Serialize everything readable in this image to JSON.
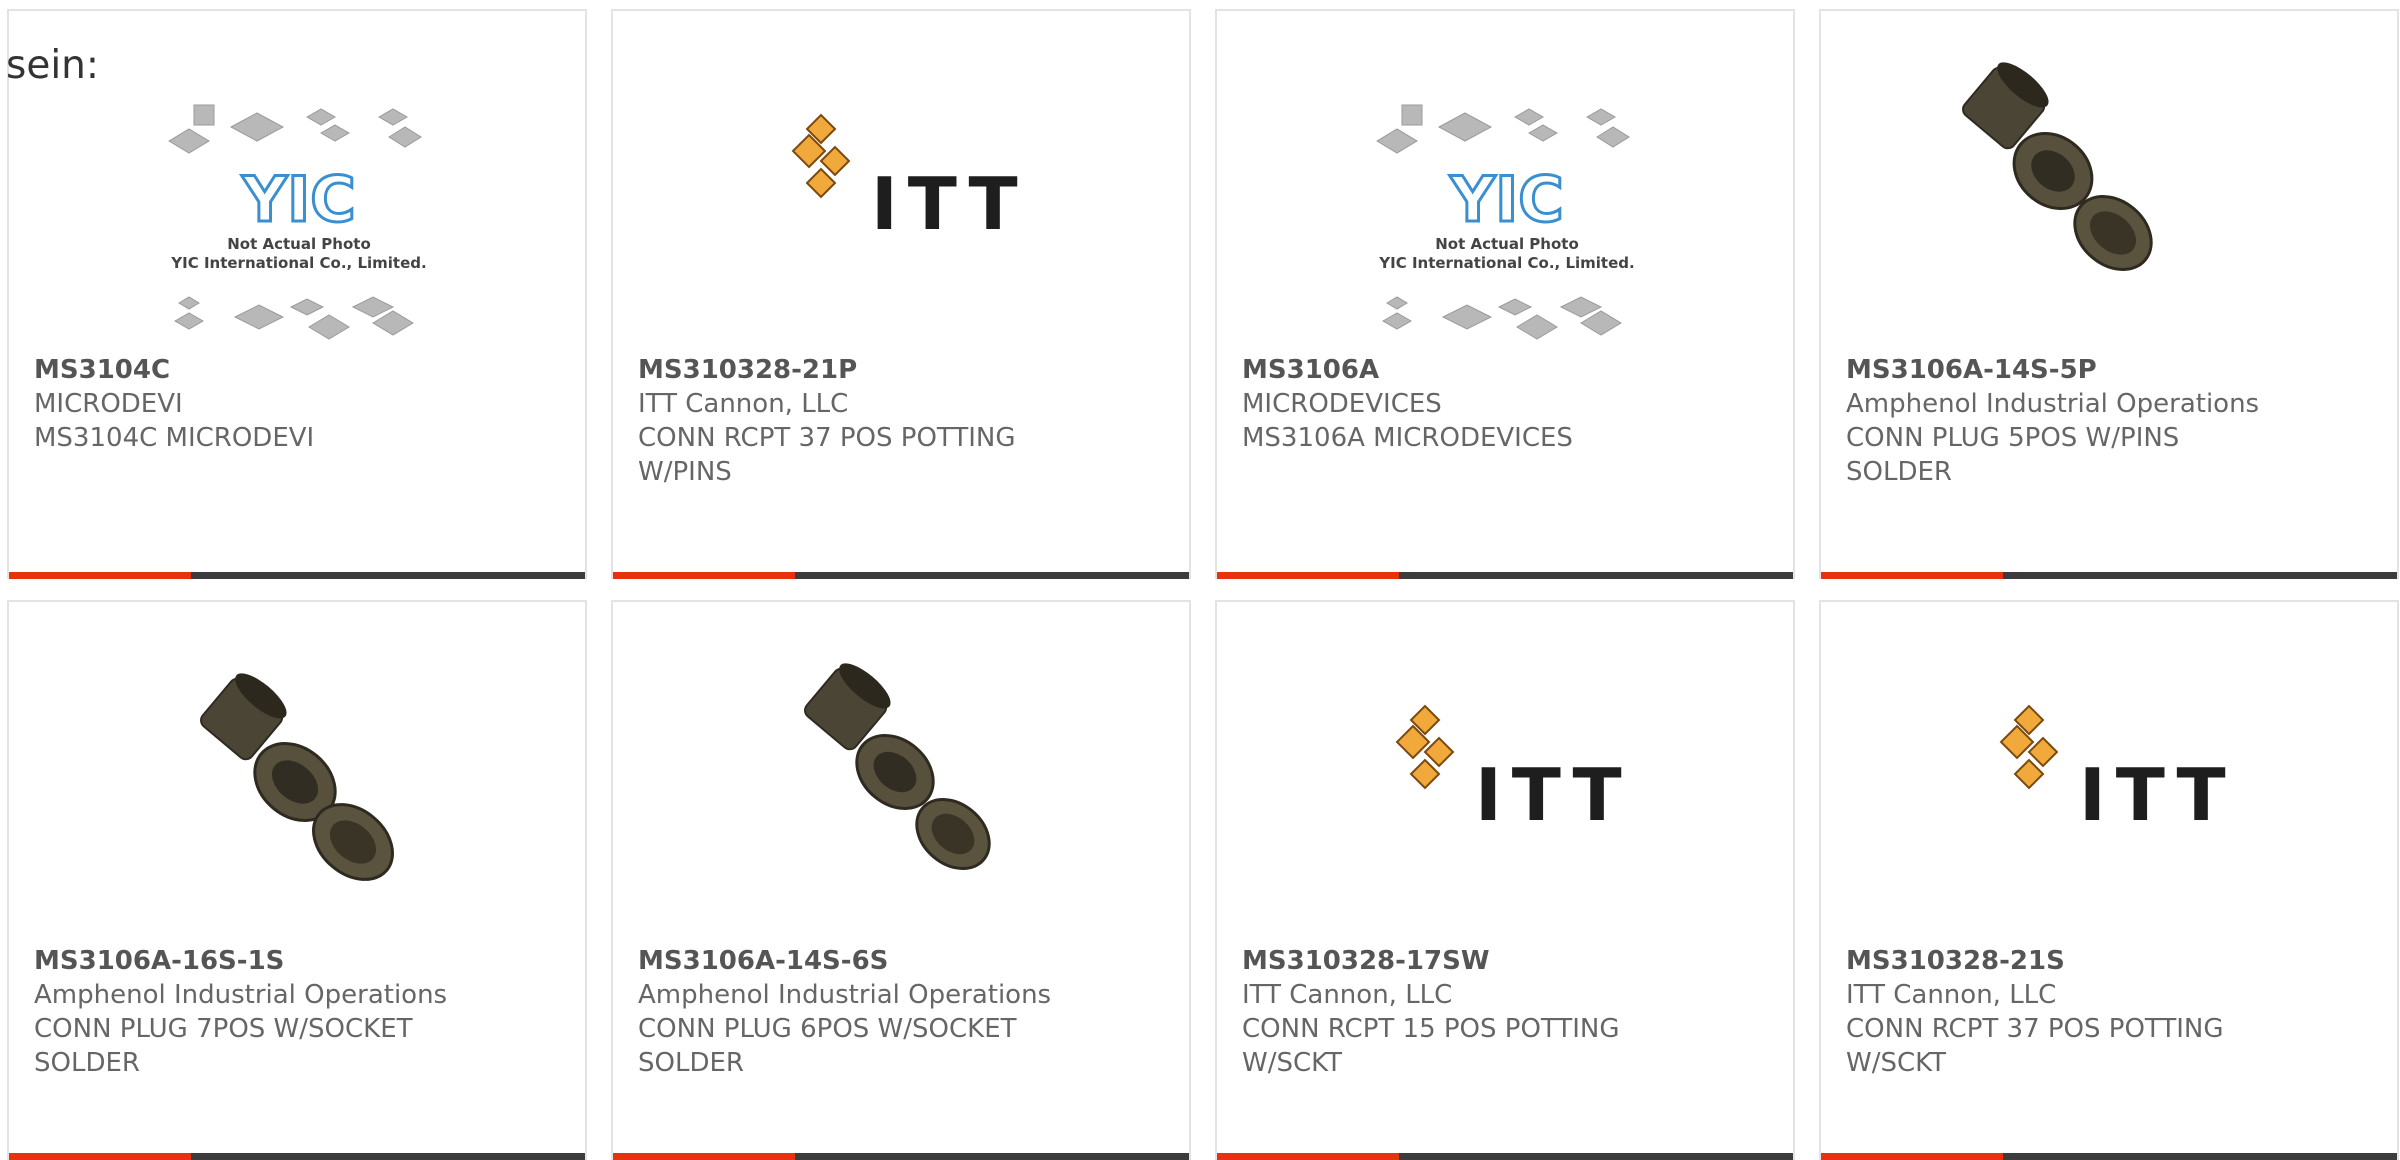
{
  "intro_text": "sein:",
  "colors": {
    "accent": "#e8320e",
    "bar": "#3c3c3c",
    "border": "#e3e3e3",
    "itt_gold": "#f2a93b",
    "yic_blue": "#3a8fd1"
  },
  "products": [
    {
      "part_number": "MS3104C",
      "manufacturer": "MICRODEVI",
      "description": "MS3104C MICRODEVI",
      "image": "yic-placeholder-image",
      "image_text": [
        "YIC",
        "Not Actual Photo",
        "YIC International Co., Limited."
      ]
    },
    {
      "part_number": "MS310328-21P",
      "manufacturer": "ITT Cannon, LLC",
      "description": "CONN RCPT 37 POS POTTING W/PINS",
      "image": "itt-logo-image",
      "image_text": [
        "ITT"
      ]
    },
    {
      "part_number": "MS3106A",
      "manufacturer": "MICRODEVICES",
      "description": "MS3106A MICRODEVICES",
      "image": "yic-placeholder-image",
      "image_text": [
        "YIC",
        "Not Actual Photo",
        "YIC International Co., Limited."
      ]
    },
    {
      "part_number": "MS3106A-14S-5P",
      "manufacturer": "Amphenol Industrial Operations",
      "description": "CONN PLUG 5POS W/PINS SOLDER",
      "image": "connector-photo"
    },
    {
      "part_number": "MS3106A-16S-1S",
      "manufacturer": "Amphenol Industrial Operations",
      "description": "CONN PLUG 7POS W/SOCKET SOLDER",
      "image": "connector-photo"
    },
    {
      "part_number": "MS3106A-14S-6S",
      "manufacturer": "Amphenol Industrial Operations",
      "description": "CONN PLUG 6POS W/SOCKET SOLDER",
      "image": "connector-photo"
    },
    {
      "part_number": "MS310328-17SW",
      "manufacturer": "ITT Cannon, LLC",
      "description": "CONN RCPT 15 POS POTTING W/SCKT",
      "image": "itt-logo-image",
      "image_text": [
        "ITT"
      ]
    },
    {
      "part_number": "MS310328-21S",
      "manufacturer": "ITT Cannon, LLC",
      "description": "CONN RCPT 37 POS POTTING W/SCKT",
      "image": "itt-logo-image",
      "image_text": [
        "ITT"
      ]
    }
  ]
}
